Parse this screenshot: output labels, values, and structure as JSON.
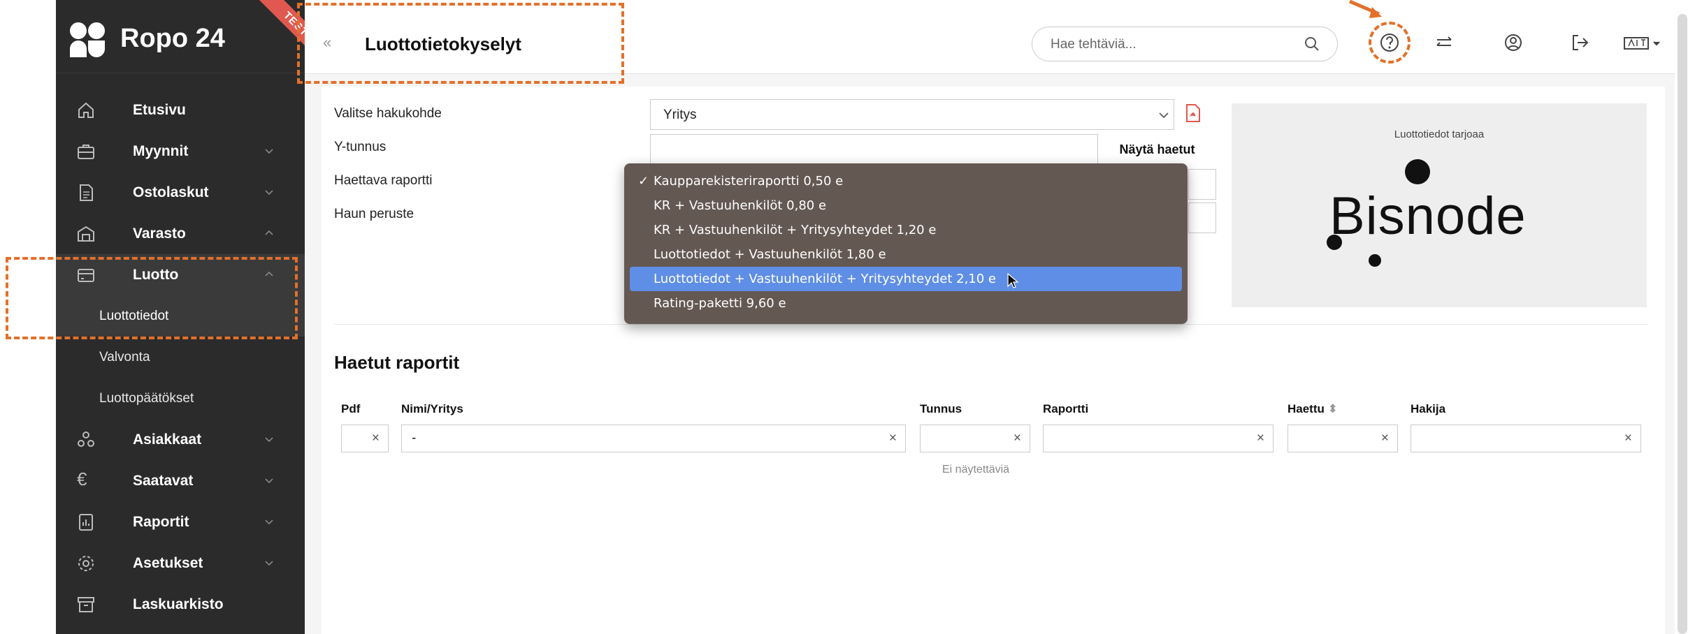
{
  "app": {
    "name": "Ropo 24",
    "ribbon": "TEST"
  },
  "sidebar": {
    "items": [
      {
        "label": "Etusivu",
        "icon": "home-icon"
      },
      {
        "label": "Myynnit",
        "icon": "briefcase-icon",
        "chevron": "down"
      },
      {
        "label": "Ostolaskut",
        "icon": "document-icon",
        "chevron": "down"
      },
      {
        "label": "Varasto",
        "icon": "warehouse-icon",
        "chevron": "up"
      },
      {
        "label": "Luotto",
        "icon": "credit-card-icon",
        "chevron": "up"
      }
    ],
    "luotto_sub": [
      {
        "label": "Luottotiedot",
        "active": true
      },
      {
        "label": "Valvonta"
      },
      {
        "label": "Luottopäätökset"
      }
    ],
    "items2": [
      {
        "label": "Asiakkaat",
        "icon": "people-icon",
        "chevron": "down"
      },
      {
        "label": "Saatavat",
        "icon": "euro-icon",
        "chevron": "down"
      },
      {
        "label": "Raportit",
        "icon": "report-icon",
        "chevron": "down"
      },
      {
        "label": "Asetukset",
        "icon": "gear-icon",
        "chevron": "down"
      },
      {
        "label": "Laskuarkisto",
        "icon": "archive-icon"
      }
    ]
  },
  "header": {
    "collapse": "«",
    "title": "Luottotietokyselyt",
    "search_placeholder": "Hae tehtäviä...",
    "icons": [
      "help-icon",
      "switch-icon",
      "user-icon",
      "logout-icon",
      "language-icon"
    ]
  },
  "form": {
    "labels": [
      "Valitse hakukohde",
      "Y-tunnus",
      "Haettava raportti",
      "Haun peruste"
    ],
    "target_value": "Yritys",
    "show_button": "Näytä haetut",
    "dropdown": [
      {
        "label": "Kaupparekisteriraportti 0,50 e",
        "checked": true
      },
      {
        "label": "KR + Vastuuhenkilöt 0,80 e"
      },
      {
        "label": "KR + Vastuuhenkilöt + Yritysyhteydet 1,20 e"
      },
      {
        "label": "Luottotiedot + Vastuuhenkilöt 1,80 e"
      },
      {
        "label": "Luottotiedot + Vastuuhenkilöt + Yritysyhteydet 2,10 e",
        "highlighted": true
      },
      {
        "label": "Rating-paketti 9,60 e"
      }
    ],
    "check_glyph": "✓"
  },
  "provider": {
    "caption": "Luottotiedot tarjoaa",
    "name": "Bisnode"
  },
  "reports": {
    "title": "Haetut raportit",
    "columns": [
      "Pdf",
      "Nimi/Yritys",
      "Tunnus",
      "Raportti",
      "Haettu",
      "Hakija"
    ],
    "name_filter_value": "-",
    "clear_glyph": "×",
    "sort_glyph": "⬍",
    "empty": "Ei näytettäviä"
  },
  "colors": {
    "sidebar": "#2b2b2b",
    "highlight": "#5f8ee6",
    "annotation": "#e2702a",
    "dropdown": "#5f534c"
  }
}
